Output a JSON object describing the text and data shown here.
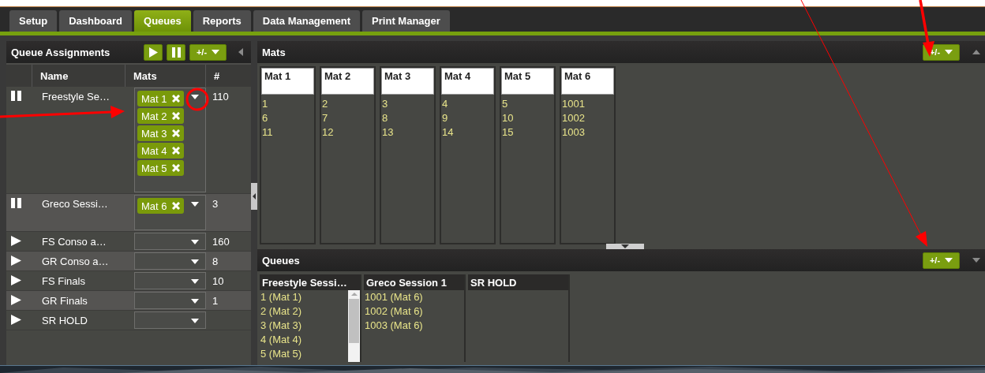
{
  "tabs": [
    {
      "label": "Setup",
      "selected": false
    },
    {
      "label": "Dashboard",
      "selected": false
    },
    {
      "label": "Queues",
      "selected": true
    },
    {
      "label": "Reports",
      "selected": false
    },
    {
      "label": "Data Management",
      "selected": false
    },
    {
      "label": "Print Manager",
      "selected": false
    }
  ],
  "queue_assignments": {
    "title": "Queue Assignments",
    "add_remove_button": "+/-",
    "columns": [
      "Name",
      "Mats",
      "#"
    ],
    "rows": [
      {
        "paused": true,
        "name": "Freestyle Se…",
        "mats": [
          "Mat 1",
          "Mat 2",
          "Mat 3",
          "Mat 4",
          "Mat 5"
        ],
        "count": "110"
      },
      {
        "paused": true,
        "name": "Greco Sessi…",
        "mats": [
          "Mat 6"
        ],
        "count": "3"
      },
      {
        "paused": false,
        "name": "FS Conso a…",
        "mats": [],
        "count": "160"
      },
      {
        "paused": false,
        "name": "GR Conso a…",
        "mats": [],
        "count": "8"
      },
      {
        "paused": false,
        "name": "FS Finals",
        "mats": [],
        "count": "10"
      },
      {
        "paused": false,
        "name": "GR Finals",
        "mats": [],
        "count": "1"
      },
      {
        "paused": false,
        "name": "SR HOLD",
        "mats": []
      }
    ]
  },
  "mats_panel": {
    "title": "Mats",
    "add_remove_button": "+/-",
    "mats": [
      {
        "name": "Mat 1",
        "bouts": [
          "1",
          "6",
          "11"
        ]
      },
      {
        "name": "Mat 2",
        "bouts": [
          "2",
          "7",
          "12"
        ]
      },
      {
        "name": "Mat 3",
        "bouts": [
          "3",
          "8",
          "13"
        ]
      },
      {
        "name": "Mat 4",
        "bouts": [
          "4",
          "9",
          "14"
        ]
      },
      {
        "name": "Mat 5",
        "bouts": [
          "5",
          "10",
          "15"
        ]
      },
      {
        "name": "Mat 6",
        "bouts": [
          "1001",
          "1002",
          "1003"
        ]
      }
    ]
  },
  "queues_panel": {
    "title": "Queues",
    "add_remove_button": "+/-",
    "queues": [
      {
        "name": "Freestyle Sessi…",
        "bouts": [
          "1 (Mat 1)",
          "2 (Mat 2)",
          "3 (Mat 3)",
          "4 (Mat 4)",
          "5 (Mat 5)"
        ]
      },
      {
        "name": "Greco Session 1",
        "bouts": [
          "1001 (Mat 6)",
          "1002 (Mat 6)",
          "1003 (Mat 6)"
        ]
      },
      {
        "name": "SR HOLD"
      }
    ]
  }
}
